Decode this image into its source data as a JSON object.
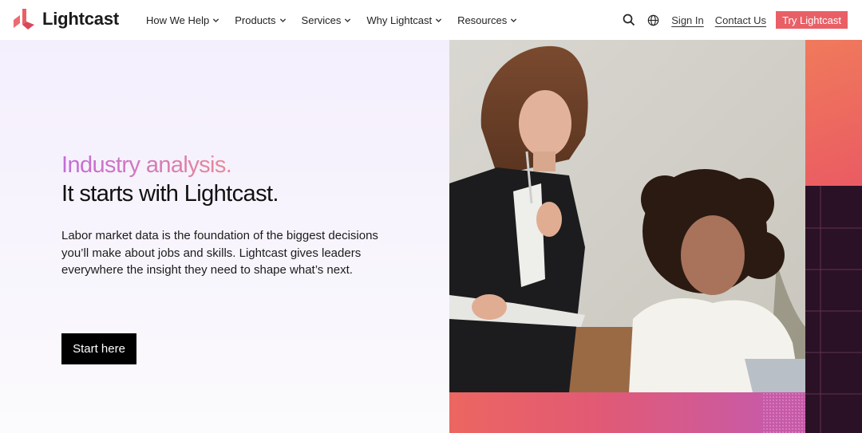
{
  "brand": {
    "name": "Lightcast",
    "accent": "#e95f66"
  },
  "nav": {
    "items": [
      {
        "label": "How We Help",
        "icon": "chevron-down-icon"
      },
      {
        "label": "Products",
        "icon": "chevron-down-icon"
      },
      {
        "label": "Services",
        "icon": "chevron-down-icon"
      },
      {
        "label": "Why Lightcast",
        "icon": "chevron-down-icon"
      },
      {
        "label": "Resources",
        "icon": "chevron-down-icon"
      }
    ]
  },
  "header_actions": {
    "search_icon": "search-icon",
    "language_icon": "globe-icon",
    "sign_in": "Sign In",
    "contact_us": "Contact Us",
    "try_button": "Try Lightcast"
  },
  "hero": {
    "eyebrow": "Industry analysis.",
    "headline": "It starts with Lightcast.",
    "body": "Labor market data is the foundation of the biggest decisions you’ll make about jobs and skills. Lightcast gives leaders everywhere the insight they need to shape what’s next.",
    "cta": "Start here"
  },
  "colors": {
    "eyebrow_gradient": [
      "#c36bdc",
      "#e98a96"
    ],
    "deco_coral": "#ea5b63",
    "deco_plum": "#2b1126",
    "deco_magenta": "#c35ab1"
  }
}
